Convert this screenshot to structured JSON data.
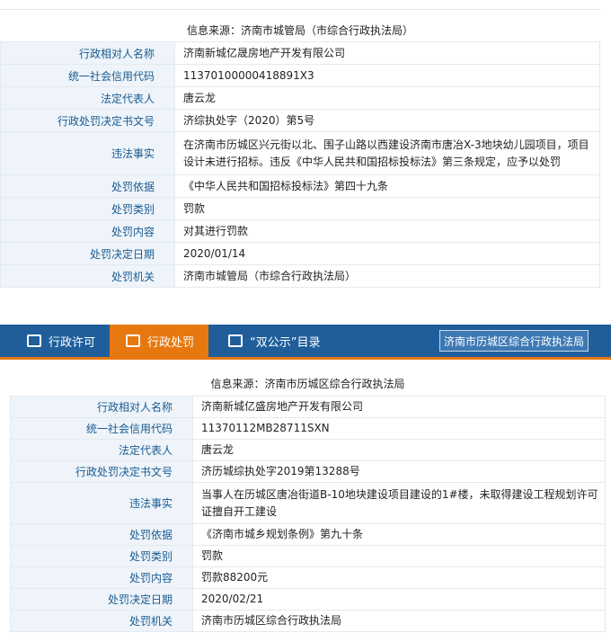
{
  "panel1": {
    "source": "信息来源：济南市城管局（市综合行政执法局）",
    "rows": [
      {
        "label": "行政相对人名称",
        "value": "济南新城亿晟房地产开发有限公司"
      },
      {
        "label": "统一社会信用代码",
        "value": "11370100000418891X3"
      },
      {
        "label": "法定代表人",
        "value": "唐云龙"
      },
      {
        "label": "行政处罚决定书文号",
        "value": "济综执处字（2020）第5号"
      },
      {
        "label": "违法事实",
        "value": "在济南市历城区兴元街以北、围子山路以西建设济南市唐冶X-3地块幼儿园项目，项目设计未进行招标。违反《中华人民共和国招标投标法》第三条规定，应予以处罚"
      },
      {
        "label": "处罚依据",
        "value": "《中华人民共和国招标投标法》第四十九条"
      },
      {
        "label": "处罚类别",
        "value": "罚款"
      },
      {
        "label": "处罚内容",
        "value": "对其进行罚款"
      },
      {
        "label": "处罚决定日期",
        "value": "2020/01/14"
      },
      {
        "label": "处罚机关",
        "value": "济南市城管局（市综合行政执法局）"
      }
    ]
  },
  "nav": {
    "items": [
      {
        "label": "行政许可",
        "icon": "edit-icon"
      },
      {
        "label": "行政处罚",
        "icon": "list-icon"
      },
      {
        "label": "“双公示”目录",
        "icon": "calendar-icon"
      }
    ],
    "agency": "济南市历城区综合行政执法局",
    "colors": {
      "bar": "#1f5e9b",
      "active": "#e7780f"
    }
  },
  "panel2": {
    "source": "信息来源：济南市历城区综合行政执法局",
    "rows": [
      {
        "label": "行政相对人名称",
        "value": "济南新城亿盛房地产开发有限公司"
      },
      {
        "label": "统一社会信用代码",
        "value": "11370112MB28711SXN"
      },
      {
        "label": "法定代表人",
        "value": "唐云龙"
      },
      {
        "label": "行政处罚决定书文号",
        "value": "济历城综执处字2019第13288号"
      },
      {
        "label": "违法事实",
        "value": "当事人在历城区唐冶街道B-10地块建设项目建设的1#楼，未取得建设工程规划许可证擅自开工建设"
      },
      {
        "label": "处罚依据",
        "value": "《济南市城乡规划条例》第九十条"
      },
      {
        "label": "处罚类别",
        "value": "罚款"
      },
      {
        "label": "处罚内容",
        "value": "罚款88200元"
      },
      {
        "label": "处罚决定日期",
        "value": "2020/02/21"
      },
      {
        "label": "处罚机关",
        "value": "济南市历城区综合行政执法局"
      }
    ]
  }
}
